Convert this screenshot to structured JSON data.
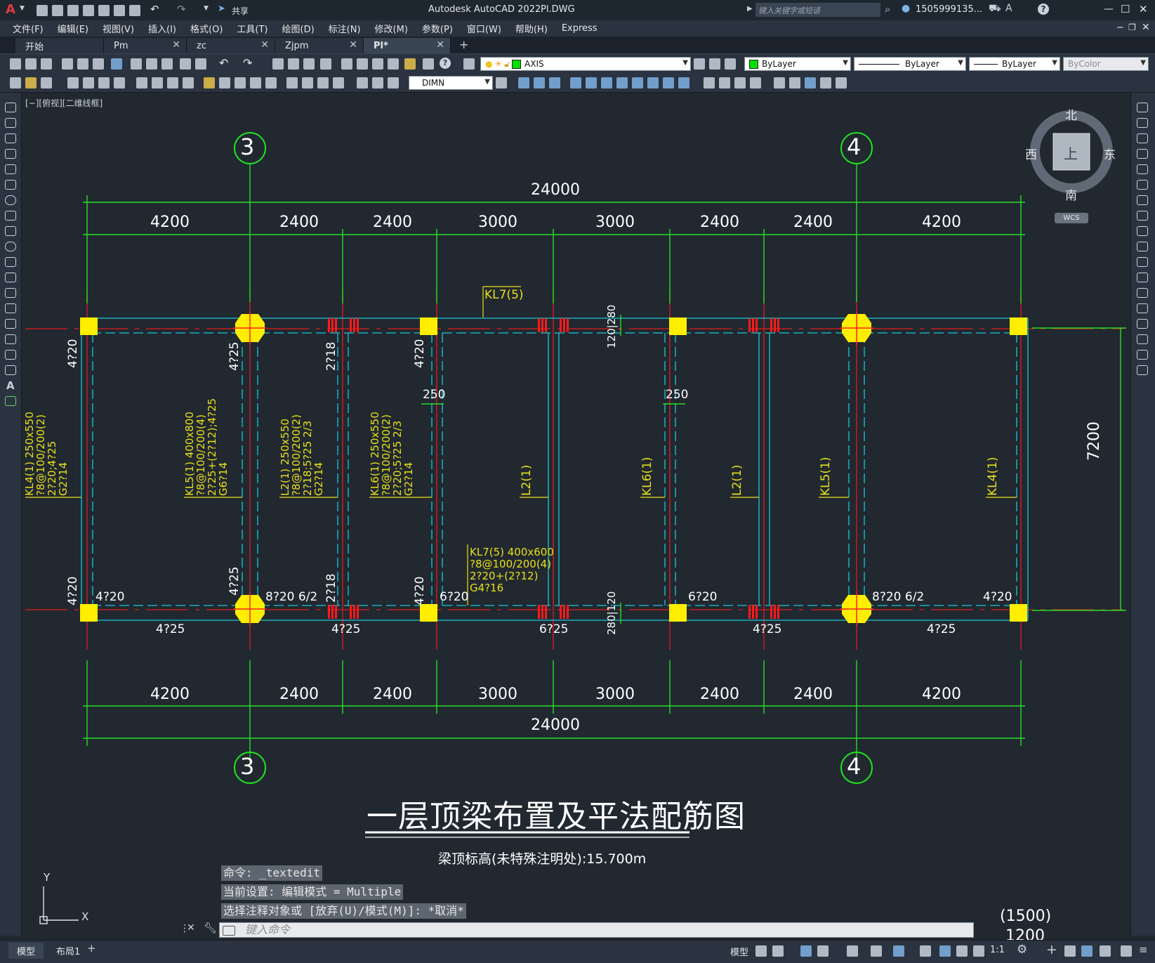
{
  "title_bar": {
    "app_logo": "A",
    "share_label": "共享",
    "title": "Autodesk AutoCAD 2022",
    "filename": "Pl.DWG",
    "search_placeholder": "键入关键字或短语",
    "user": "1505999135...",
    "minimize": "—",
    "maximize": "☐",
    "close": "✕"
  },
  "menu": {
    "items": [
      "文件(F)",
      "编辑(E)",
      "视图(V)",
      "插入(I)",
      "格式(O)",
      "工具(T)",
      "绘图(D)",
      "标注(N)",
      "修改(M)",
      "参数(P)",
      "窗口(W)",
      "帮助(H)",
      "Express"
    ]
  },
  "doc_tabs": [
    {
      "label": "开始"
    },
    {
      "label": "Pm"
    },
    {
      "label": "zc"
    },
    {
      "label": "Zjpm"
    },
    {
      "label": "Pl*",
      "active": true
    }
  ],
  "toolbar": {
    "layer_value": "AXIS",
    "color_value": "ByLayer",
    "linetype_value": "ByLayer",
    "lineweight_value": "ByLayer",
    "plotstyle_value": "ByColor",
    "dimstyle_value": "DIMN"
  },
  "viewport_label": "[−][俯视][二维线框]",
  "viewcube": {
    "north": "北",
    "south": "南",
    "east": "东",
    "west": "西",
    "top": "上",
    "wcs": "WCS"
  },
  "drawing": {
    "axis_labels": {
      "left": "3",
      "right": "4"
    },
    "total_dim": "24000",
    "segment_dims": [
      "4200",
      "2400",
      "2400",
      "3000",
      "3000",
      "2400",
      "2400",
      "4200"
    ],
    "vertical_dim": "7200",
    "title": "一层顶梁布置及平法配筋图",
    "subtitle": "梁顶标高(未特殊注明处):15.700m",
    "top_beam_tag": "KL7(5)",
    "offset_top": "120|280",
    "offset_bottom": "280|120",
    "col_offset": "250",
    "beam_notes": {
      "kl7": [
        "KL7(5) 400x600",
        "?8@100/200(4)",
        "2?20+(2?12)",
        "G4?16"
      ],
      "kl4_left": [
        "KL4(1) 250x550",
        "?8@100/200(2)",
        "2?20;4?25",
        "G2?14"
      ],
      "kl5_left": [
        "KL5(1) 400x800",
        "?8@100/200(4)",
        "2?25+(2?12);4?25",
        "G6?14"
      ],
      "l2_left": [
        "L2(1) 250x550",
        "?8@100/200(2)",
        "2?18;5?25 2/3",
        "G2?14"
      ],
      "kl6_left": [
        "KL6(1) 250x550",
        "?8@100/200(2)",
        "2?20;5?25 2/3",
        "G2?14"
      ]
    },
    "short_tags": [
      "L2(1)",
      "KL6(1)",
      "L2(1)",
      "KL5(1)",
      "KL4(1)"
    ],
    "top_rebars": [
      "4?20",
      "4?25",
      "2?18",
      "4?20"
    ],
    "bot_rebars": [
      "4?20",
      "4?25",
      "2?18",
      "4?20"
    ],
    "bottom_labels": [
      "4?20",
      "8?20 6/2",
      "6?20",
      "6?20",
      "8?20 6/2",
      "4?20"
    ],
    "under_labels": [
      "4?25",
      "4?25",
      "6?25",
      "4?25",
      "4?25"
    ],
    "corner_note_1": "(1500)",
    "corner_note_2": "1200",
    "ucs_x": "X",
    "ucs_y": "Y"
  },
  "command": {
    "lines": [
      "命令: _textedit",
      "当前设置: 编辑模式 = Multiple",
      "选择注释对象或 [放弃(U)/模式(M)]: *取消*"
    ],
    "input_placeholder": "键入命令"
  },
  "status": {
    "layout_tabs": [
      "模型",
      "布局1"
    ],
    "model_label": "模型",
    "scale": "1:1"
  }
}
